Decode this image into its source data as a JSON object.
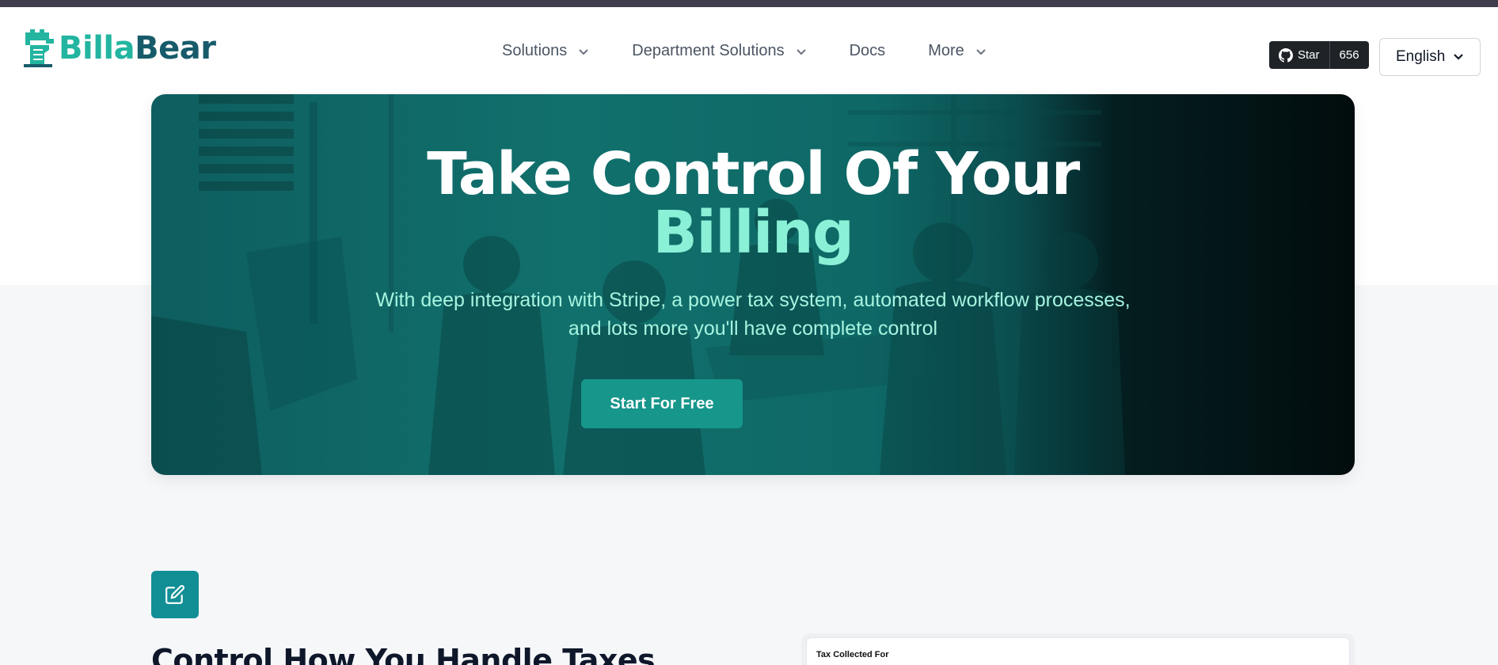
{
  "brand": {
    "name_part1": "Billa",
    "name_part2": "Bear",
    "color_primary": "#23b5a0",
    "color_dark": "#175b6b"
  },
  "nav": {
    "items": [
      {
        "label": "Solutions",
        "has_dropdown": true
      },
      {
        "label": "Department Solutions",
        "has_dropdown": true
      },
      {
        "label": "Docs",
        "has_dropdown": false
      },
      {
        "label": "More",
        "has_dropdown": true
      }
    ]
  },
  "github": {
    "star_label": "Star",
    "count": "656",
    "icon": "github-icon"
  },
  "language": {
    "selected": "English"
  },
  "hero": {
    "title_line1": "Take Control Of Your",
    "title_line2": "Billing",
    "subtitle_line1": "With deep integration with Stripe, a power tax system, automated workflow processes,",
    "subtitle_line2": "and lots more you'll have complete control",
    "cta": "Start For Free",
    "accent_color": "#8af0d6"
  },
  "feature": {
    "icon": "edit-icon",
    "title": "Control How You Handle Taxes",
    "card_title": "Tax Collected For"
  }
}
